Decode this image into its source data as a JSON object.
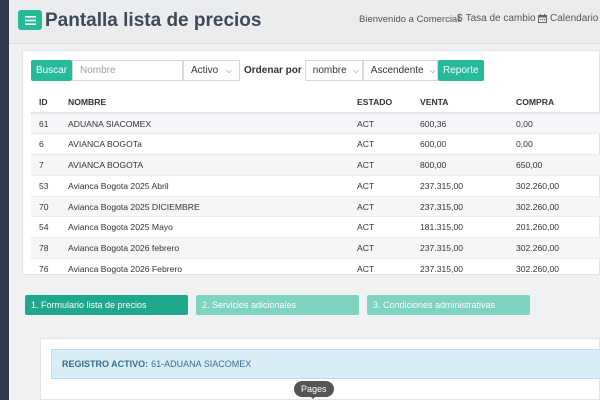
{
  "header": {
    "menu_icon": "hamburger-icon",
    "title": "Pantalla lista de precios",
    "welcome": "Bienvenido a Comercial.",
    "exchange_rate_label": "Tasa de cambio",
    "exchange_rate_icon": "$",
    "calendar_label": "Calendario",
    "calendar_icon": "calendar-icon"
  },
  "toolbar": {
    "search_button": "Buscar",
    "name_placeholder": "Nombre",
    "status_value": "Activo",
    "order_label": "Ordenar por",
    "order_field_value": "nombre",
    "order_dir_value": "Ascendente",
    "report_button": "Reporte"
  },
  "table": {
    "headers": [
      "ID",
      "NOMBRE",
      "ESTADO",
      "VENTA",
      "COMPRA"
    ],
    "rows": [
      [
        "61",
        "ADUANA SIACOMEX",
        "ACT",
        "600,36",
        "0,00"
      ],
      [
        "6",
        "AVIANCA BOGOTa",
        "ACT",
        "600,00",
        "0,00"
      ],
      [
        "7",
        "AVIANCA BOGOTA",
        "ACT",
        "800,00",
        "650,00"
      ],
      [
        "53",
        "Avianca Bogota 2025 Abril",
        "ACT",
        "237.315,00",
        "302.260,00"
      ],
      [
        "70",
        "Avianca Bogota 2025 DICIEMBRE",
        "ACT",
        "237.315,00",
        "302.260,00"
      ],
      [
        "54",
        "Avianca Bogota 2025 Mayo",
        "ACT",
        "181.315,00",
        "201.260,00"
      ],
      [
        "78",
        "Avianca Bogota 2026 febrero",
        "ACT",
        "237.315,00",
        "302.260,00"
      ],
      [
        "76",
        "Avianca Bogota 2026 Febrero",
        "ACT",
        "237.315,00",
        "302.260,00"
      ]
    ]
  },
  "tabs": [
    "1. Formulario lista de precios",
    "2. Servicios adicionales",
    "3. Condiciones administrativas"
  ],
  "active_record": {
    "label": "REGISTRO ACTIVO:",
    "value": "61-ADUANA SIACOMEX"
  },
  "tooltip": "Pages",
  "colors": {
    "accent": "#26b99a",
    "tab_active": "#1fa88d",
    "tab_inactive": "#7ed3c1",
    "alert_bg": "#d9edf7",
    "sidebar": "#2c3a4b"
  }
}
